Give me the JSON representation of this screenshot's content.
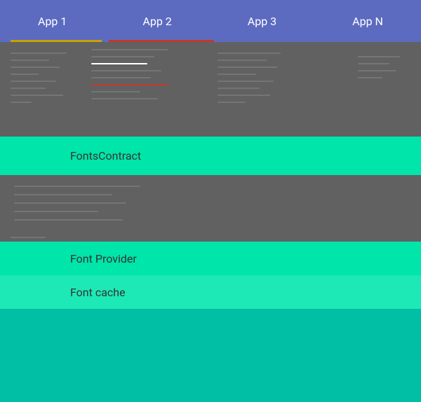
{
  "appBar": {
    "tabs": [
      {
        "label": "App 1",
        "id": "app1"
      },
      {
        "label": "App 2",
        "id": "app2"
      },
      {
        "label": "App 3",
        "id": "app3"
      },
      {
        "label": "App N",
        "id": "appN"
      }
    ]
  },
  "blocks": {
    "fontsContract": "FontsContract",
    "fontProvider": "Font Provider",
    "fontCache": "Font cache"
  },
  "colors": {
    "appBar": "#5c6bc0",
    "darkSection": "#616161",
    "tealMain": "#00e5aa",
    "tealLight": "#1de9b6",
    "tealBottom": "#00bfa5"
  }
}
